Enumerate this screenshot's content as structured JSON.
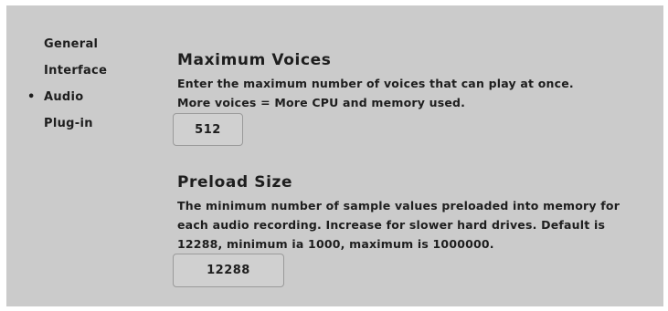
{
  "sidebar": {
    "items": [
      {
        "label": "General",
        "active": false
      },
      {
        "label": "Interface",
        "active": false
      },
      {
        "label": "Audio",
        "active": true
      },
      {
        "label": "Plug-in",
        "active": false
      }
    ],
    "active_bullet": "•"
  },
  "max_voices": {
    "title": "Maximum Voices",
    "desc_line1": "Enter the maximum number of voices that can play at once.",
    "desc_line2": "More voices = More CPU and memory used.",
    "value": "512"
  },
  "preload": {
    "title": "Preload Size",
    "desc_line1": "The minimum number of sample values preloaded into memory for",
    "desc_line2": "each audio recording. Increase for slower hard drives. Default is",
    "desc_line3": "12288, minimum ia 1000, maximum is 1000000.",
    "value": "12288"
  }
}
